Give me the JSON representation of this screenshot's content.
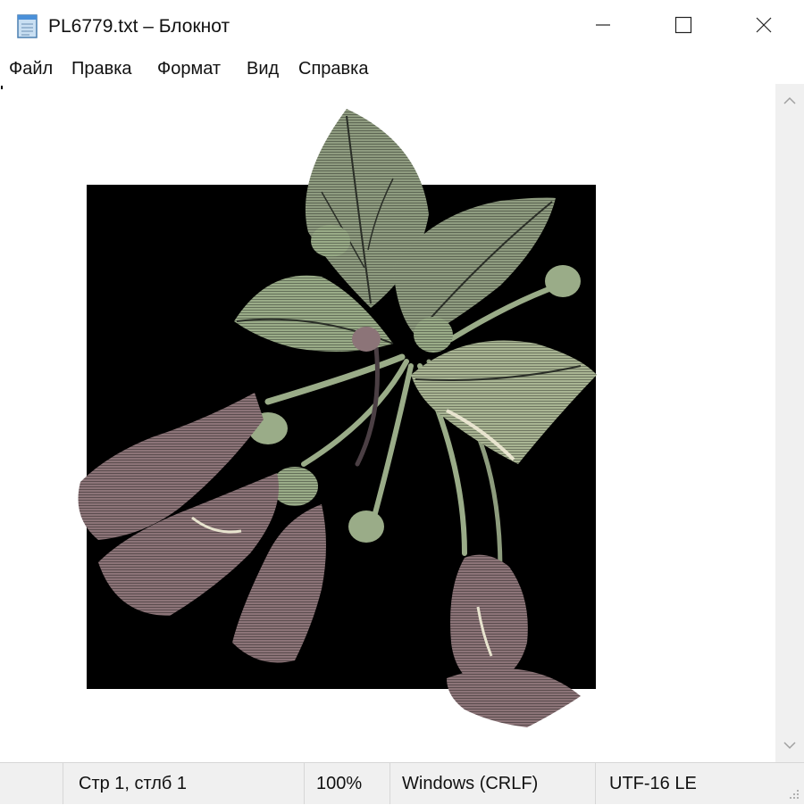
{
  "window": {
    "title": "PL6779.txt – Блокнот",
    "icon": "notepad-icon",
    "controls": {
      "minimize_icon": "minimize-icon",
      "maximize_icon": "maximize-icon",
      "close_icon": "close-icon"
    }
  },
  "menu": {
    "items": [
      {
        "label": "Файл"
      },
      {
        "label": "Правка"
      },
      {
        "label": "Формат"
      },
      {
        "label": "Вид"
      },
      {
        "label": "Справка"
      }
    ]
  },
  "editor": {
    "content_description_colors": {
      "background_block": "#000000",
      "leaf_green": "#9aac88",
      "leaf_dark": "#5a6652",
      "flower_mauve": "#8c7478",
      "flower_dark": "#4b3f44",
      "highlight": "#e8e4cf"
    }
  },
  "status": {
    "position": "Стр 1, стлб 1",
    "zoom": "100%",
    "line_ending": "Windows (CRLF)",
    "encoding": "UTF-16 LE"
  },
  "colors": {
    "chrome": "#f0f0f0",
    "divider": "#d7d7d7",
    "text": "#111111"
  }
}
